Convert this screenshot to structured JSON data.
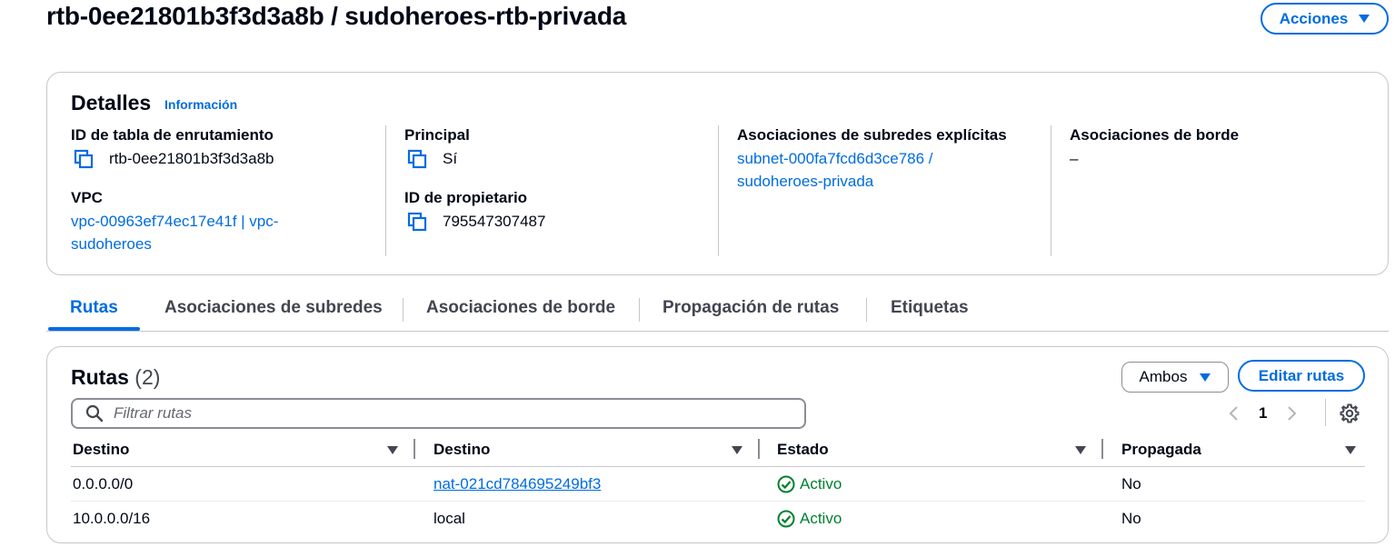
{
  "header": {
    "title": "rtb-0ee21801b3f3d3a8b / sudoheroes-rtb-privada",
    "actions_label": "Acciones"
  },
  "details": {
    "title": "Detalles",
    "info_link": "Información",
    "route_table_id_label": "ID de tabla de enrutamiento",
    "route_table_id": "rtb-0ee21801b3f3d3a8b",
    "vpc_label": "VPC",
    "vpc_line1": "vpc-00963ef74ec17e41f | vpc-",
    "vpc_line2": "sudoheroes",
    "main_label": "Principal",
    "main_value": "Sí",
    "owner_label": "ID de propietario",
    "owner_value": "795547307487",
    "subnet_assoc_label": "Asociaciones de subredes explícitas",
    "subnet_assoc_line1": "subnet-000fa7fcd6d3ce786 /",
    "subnet_assoc_line2": "sudoheroes-privada",
    "edge_assoc_label": "Asociaciones de borde",
    "edge_assoc_value": "–"
  },
  "tabs": [
    {
      "label": "Rutas",
      "active": true
    },
    {
      "label": "Asociaciones de subredes",
      "active": false
    },
    {
      "label": "Asociaciones de borde",
      "active": false
    },
    {
      "label": "Propagación de rutas",
      "active": false
    },
    {
      "label": "Etiquetas",
      "active": false
    }
  ],
  "routes": {
    "title": "Rutas",
    "count": "(2)",
    "filter_selected": "Ambos",
    "edit_label": "Editar rutas",
    "filter_placeholder": "Filtrar rutas",
    "current_page": "1",
    "columns": [
      "Destino",
      "Destino",
      "Estado",
      "Propagada"
    ],
    "rows": [
      {
        "destination": "0.0.0.0/0",
        "target": "nat-021cd784695249bf3",
        "target_is_link": true,
        "status": "Activo",
        "propagated": "No"
      },
      {
        "destination": "10.0.0.0/16",
        "target": "local",
        "target_is_link": false,
        "status": "Activo",
        "propagated": "No"
      }
    ]
  },
  "colors": {
    "accent": "#006ce0",
    "text": "#000716",
    "success": "#00802f",
    "border": "#c6c6cd"
  },
  "icons": [
    "copy-icon",
    "search-icon",
    "chevron-left-icon",
    "chevron-right-icon",
    "gear-icon",
    "status-success-icon",
    "caret-down-icon"
  ]
}
